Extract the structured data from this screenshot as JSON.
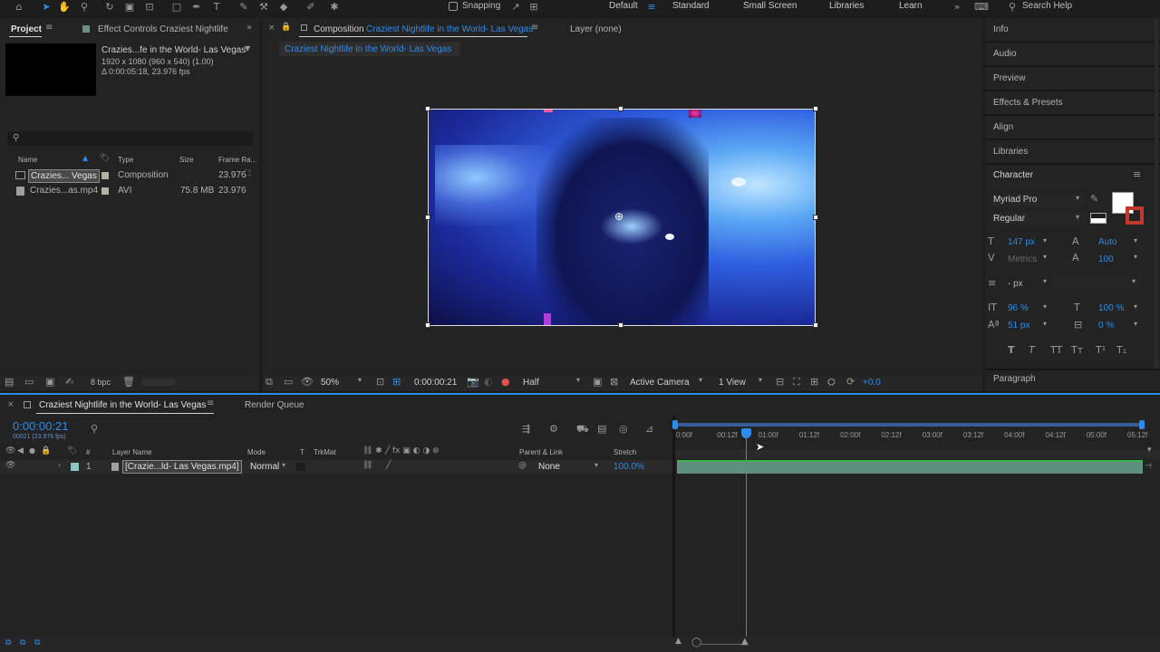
{
  "toolbar": {
    "snapping_label": "Snapping",
    "workspaces": [
      "Default",
      "Standard",
      "Small Screen",
      "Libraries",
      "Learn"
    ],
    "search_label": "Search Help"
  },
  "project": {
    "tab_project": "Project",
    "tab_effect_controls": "Effect Controls Craziest Nightlife",
    "item_name": "Crazies...fe in the World- Las Vegas",
    "item_info_1": "1920 x 1080  (960 x 540) (1.00)",
    "item_info_2": "Δ 0:00:05:18, 23.976 fps",
    "search_glyph": "⚲",
    "columns": {
      "name": "Name",
      "type": "Type",
      "size": "Size",
      "frame_rate": "Frame Ra..."
    },
    "rows": [
      {
        "name": "Crazies... Vegas",
        "type": "Composition",
        "size": "",
        "fps": "23.976"
      },
      {
        "name": "Crazies...as.mp4",
        "type": "AVI",
        "size": "75.8 MB",
        "fps": "23.976"
      }
    ],
    "bpc": "8 bpc"
  },
  "viewer": {
    "comp_tab_prefix": "Composition",
    "comp_tab_name": "Craziest Nightlife in the World- Las Vegas",
    "layer_tab": "Layer (none)",
    "breadcrumb": "Craziest Nightlife in the World- Las Vegas",
    "zoom": "50%",
    "timecode": "0:00:00:21",
    "resolution": "Half",
    "camera": "Active Camera",
    "views": "1 View",
    "exposure": "+0.0"
  },
  "right_panel": {
    "collapsed": [
      "Info",
      "Audio",
      "Preview",
      "Effects & Presets",
      "Align",
      "Libraries"
    ],
    "character_title": "Character",
    "font_family": "Myriad Pro",
    "font_style": "Regular",
    "font_size": "147 px",
    "leading": "Auto",
    "kerning": "Metrics",
    "tracking": "100",
    "stroke_width": "- px",
    "vert_scale": "96 %",
    "horiz_scale": "100 %",
    "baseline": "51 px",
    "tsume": "0 %",
    "paragraph": "Paragraph",
    "fill_color": "#ffffff"
  },
  "timeline": {
    "tab_comp": "Craziest Nightlife in the World- Las Vegas",
    "tab_render": "Render Queue",
    "timecode": "0:00:00:21",
    "timecode_sub": "00021 (23.976 fps)",
    "columns": {
      "num": "#",
      "layer_name": "Layer Name",
      "mode": "Mode",
      "t": "T",
      "trkmat": "TrkMat",
      "parent": "Parent & Link",
      "stretch": "Stretch"
    },
    "layer": {
      "index": "1",
      "name": "[Crazie...ld- Las Vegas.mp4]",
      "mode": "Normal",
      "parent": "None",
      "stretch": "100.0%"
    },
    "ruler": [
      "0:00f",
      "00:12f",
      "01:00f",
      "01:12f",
      "02:00f",
      "02:12f",
      "03:00f",
      "03:12f",
      "04:00f",
      "04:12f",
      "05:00f",
      "05:12f"
    ],
    "playhead_fraction": 0.146
  }
}
